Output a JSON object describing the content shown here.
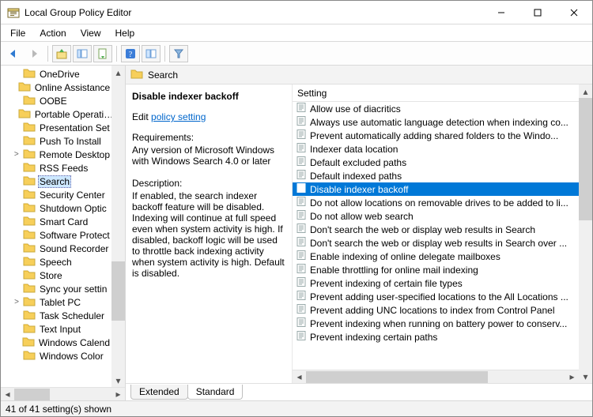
{
  "window": {
    "title": "Local Group Policy Editor"
  },
  "menu": {
    "file": "File",
    "action": "Action",
    "view": "View",
    "help": "Help"
  },
  "tree": {
    "items": [
      {
        "label": "OneDrive",
        "expander": ""
      },
      {
        "label": "Online Assistance",
        "expander": ""
      },
      {
        "label": "OOBE",
        "expander": ""
      },
      {
        "label": "Portable Operati…",
        "expander": ""
      },
      {
        "label": "Presentation Set",
        "expander": ""
      },
      {
        "label": "Push To Install",
        "expander": ""
      },
      {
        "label": "Remote Desktop",
        "expander": ">"
      },
      {
        "label": "RSS Feeds",
        "expander": ""
      },
      {
        "label": "Search",
        "expander": "",
        "selected": true
      },
      {
        "label": "Security Center",
        "expander": ""
      },
      {
        "label": "Shutdown Optic",
        "expander": ""
      },
      {
        "label": "Smart Card",
        "expander": ""
      },
      {
        "label": "Software Protect",
        "expander": ""
      },
      {
        "label": "Sound Recorder",
        "expander": ""
      },
      {
        "label": "Speech",
        "expander": ""
      },
      {
        "label": "Store",
        "expander": ""
      },
      {
        "label": "Sync your settin",
        "expander": ""
      },
      {
        "label": "Tablet PC",
        "expander": ">"
      },
      {
        "label": "Task Scheduler",
        "expander": ""
      },
      {
        "label": "Text Input",
        "expander": ""
      },
      {
        "label": "Windows Calend",
        "expander": ""
      },
      {
        "label": "Windows Color",
        "expander": ""
      }
    ]
  },
  "header": {
    "title": "Search"
  },
  "description": {
    "title": "Disable indexer backoff",
    "edit_prefix": "Edit",
    "edit_link": "policy setting",
    "req_head": "Requirements:",
    "req_text": "Any version of Microsoft Windows with Windows Search 4.0 or later",
    "desc_head": "Description:",
    "desc_text": "If enabled, the search indexer backoff feature will be disabled. Indexing will continue at full speed even when system activity is high. If disabled, backoff logic will be used to throttle back indexing activity when system activity is high. Default is disabled."
  },
  "list": {
    "header": "Setting",
    "items": [
      {
        "label": "Allow use of diacritics"
      },
      {
        "label": "Always use automatic language detection when indexing co..."
      },
      {
        "label": "Prevent automatically adding shared folders to the Windo..."
      },
      {
        "label": "Indexer data location"
      },
      {
        "label": "Default excluded paths"
      },
      {
        "label": "Default indexed paths"
      },
      {
        "label": "Disable indexer backoff",
        "selected": true
      },
      {
        "label": "Do not allow locations on removable drives to be added to li..."
      },
      {
        "label": "Do not allow web search"
      },
      {
        "label": "Don't search the web or display web results in Search"
      },
      {
        "label": "Don't search the web or display web results in Search over ..."
      },
      {
        "label": "Enable indexing of online delegate mailboxes"
      },
      {
        "label": "Enable throttling for online mail indexing"
      },
      {
        "label": "Prevent indexing of certain file types"
      },
      {
        "label": "Prevent adding user-specified locations to the All Locations ..."
      },
      {
        "label": "Prevent adding UNC locations to index from Control Panel"
      },
      {
        "label": "Prevent indexing when running on battery power to conserv..."
      },
      {
        "label": "Prevent indexing certain paths"
      }
    ]
  },
  "tabs": {
    "extended": "Extended",
    "standard": "Standard"
  },
  "status": {
    "text": "41 of 41 setting(s) shown"
  }
}
